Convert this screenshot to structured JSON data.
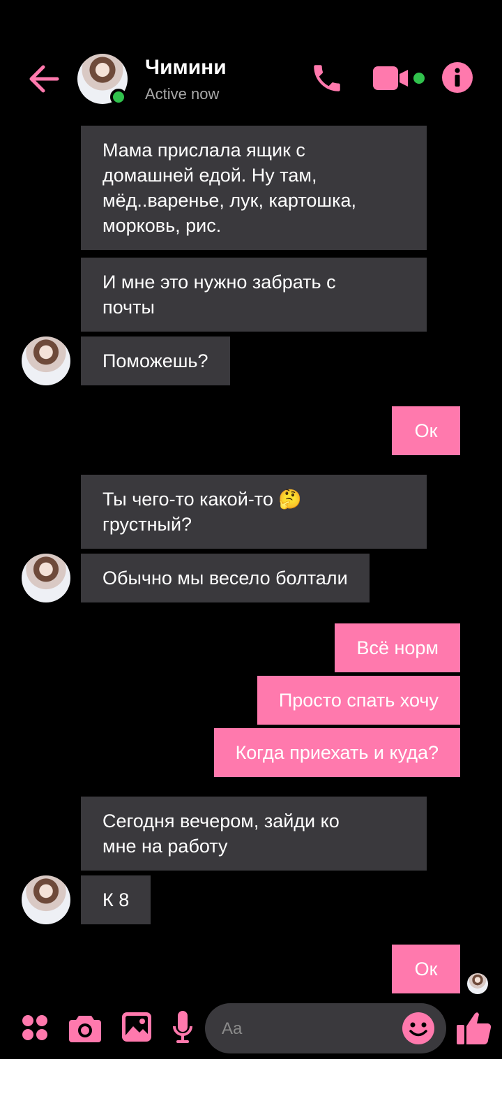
{
  "colors": {
    "accent": "#ff79ad",
    "incoming_bubble": "#3a393d",
    "online": "#31c24d"
  },
  "header": {
    "contact_name": "Чимини",
    "contact_status": "Active now",
    "icons": [
      "back-arrow-icon",
      "phone-icon",
      "video-camera-icon",
      "info-icon"
    ]
  },
  "messages": [
    {
      "dir": "in",
      "text": "Мама прислала ящик с\nдомашней едой. Ну там,\nмёд..варенье, лук, картошка,\nморковь, рис."
    },
    {
      "dir": "in",
      "text": "И мне это нужно забрать с\nпочты"
    },
    {
      "dir": "in",
      "text": "Поможешь?"
    },
    {
      "dir": "out",
      "text": "Ок"
    },
    {
      "dir": "in",
      "text": "Ты чего-то какой-то 🤔\nгрустный?"
    },
    {
      "dir": "in",
      "text": "Обычно мы весело болтали"
    },
    {
      "dir": "out",
      "text": "Всё норм"
    },
    {
      "dir": "out",
      "text": "Просто спать хочу"
    },
    {
      "dir": "out",
      "text": "Когда приехать и куда?"
    },
    {
      "dir": "in",
      "text": "Сегодня вечером, зайди ко\nмне на работу"
    },
    {
      "dir": "in",
      "text": "К 8"
    },
    {
      "dir": "out",
      "text": "Ок"
    }
  ],
  "composer": {
    "placeholder": "Aa",
    "icons": [
      "apps-icon",
      "camera-icon",
      "gallery-icon",
      "microphone-icon",
      "emoji-icon",
      "thumbs-up-icon"
    ]
  }
}
